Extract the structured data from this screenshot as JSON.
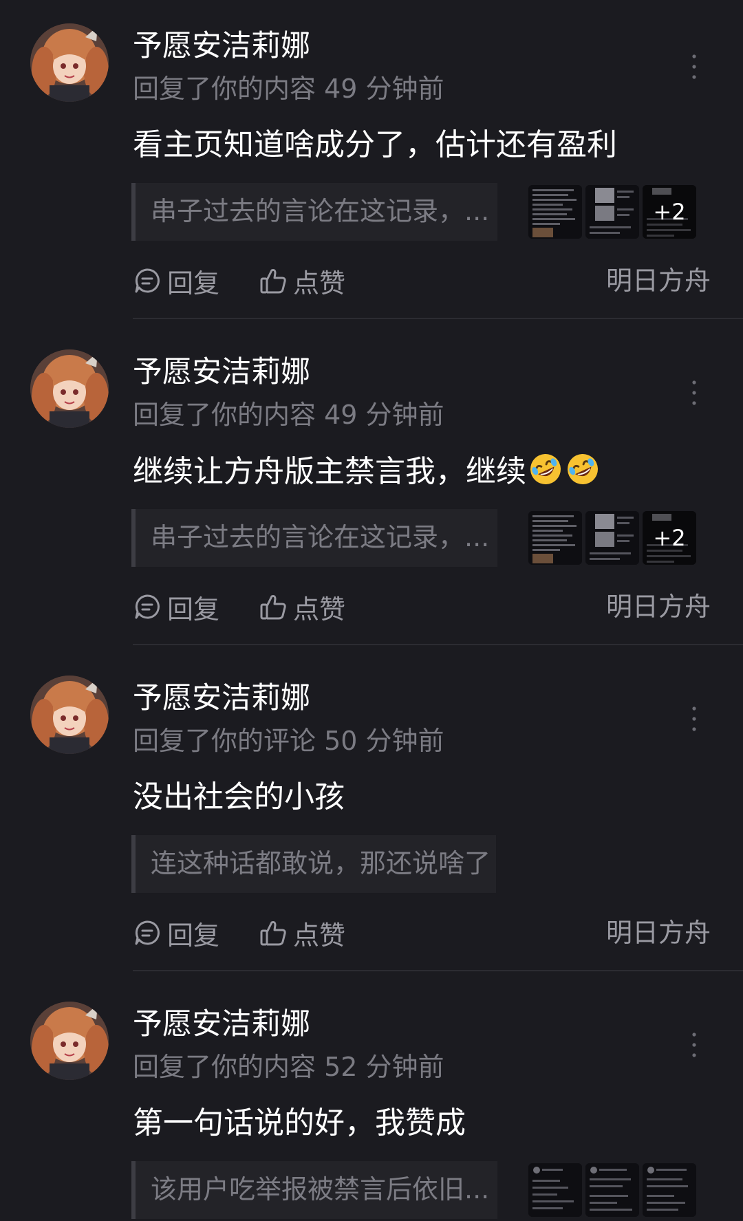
{
  "notifications": [
    {
      "username": "予愿安洁莉娜",
      "meta": "回复了你的内容 49 分钟前",
      "content": "看主页知道啥成分了，估计还有盈利",
      "emojis": [],
      "quote": "串子过去的言论在这记录，...",
      "thumb_extra": "+2",
      "reply_label": "回复",
      "like_label": "点赞",
      "tag": "明日方舟"
    },
    {
      "username": "予愿安洁莉娜",
      "meta": "回复了你的内容 49 分钟前",
      "content": "继续让方舟版主禁言我，继续",
      "emojis": [
        "rolling-on-floor-laughing-emoji",
        "rolling-on-floor-laughing-emoji"
      ],
      "quote": "串子过去的言论在这记录，...",
      "thumb_extra": "+2",
      "reply_label": "回复",
      "like_label": "点赞",
      "tag": "明日方舟"
    },
    {
      "username": "予愿安洁莉娜",
      "meta": "回复了你的评论 50 分钟前",
      "content": "没出社会的小孩",
      "emojis": [],
      "quote": "连这种话都敢说，那还说啥了",
      "thumb_extra": "",
      "reply_label": "回复",
      "like_label": "点赞",
      "tag": "明日方舟"
    },
    {
      "username": "予愿安洁莉娜",
      "meta": "回复了你的内容 52 分钟前",
      "content": "第一句话说的好，我赞成",
      "emojis": [],
      "quote": "该用户吃举报被禁言后依旧...",
      "thumb_extra": "",
      "reply_label": "",
      "like_label": "",
      "tag": ""
    }
  ],
  "colors": {
    "background": "#1b1b20",
    "text_primary": "#ffffff",
    "text_secondary": "#7b7b83",
    "action_text": "#9a9aa2",
    "quote_bg": "#232328"
  }
}
